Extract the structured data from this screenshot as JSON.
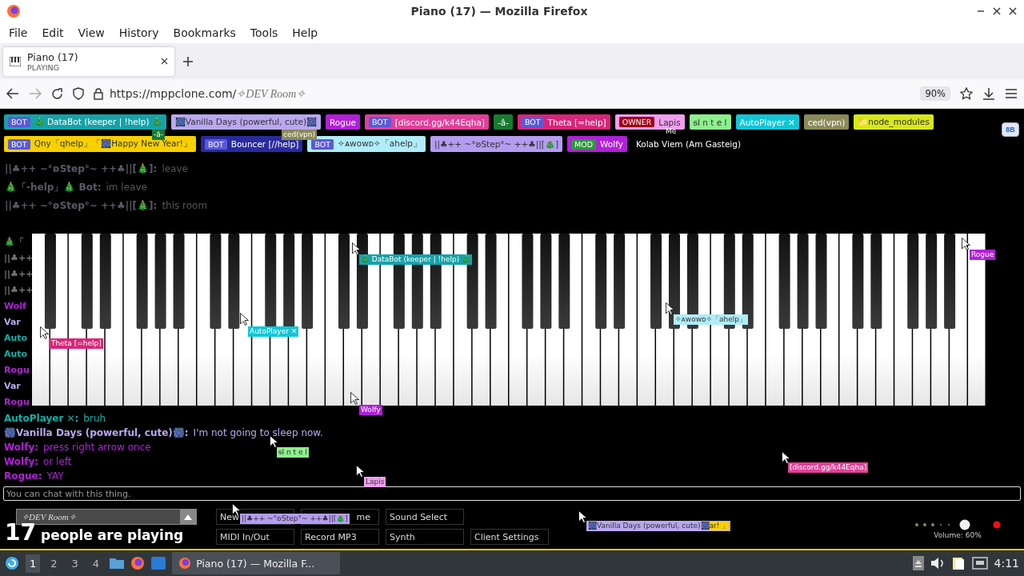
{
  "window": {
    "title": "Piano (17) — Mozilla Firefox"
  },
  "menu": [
    "File",
    "Edit",
    "View",
    "History",
    "Bookmarks",
    "Tools",
    "Help"
  ],
  "tabs": [
    {
      "title": "Piano (17)",
      "subtitle": "PLAYING",
      "selected": true
    }
  ],
  "address": {
    "url": "https://mppclone.com/",
    "room": "✧DEV Room✧",
    "zoom": "90%"
  },
  "users": [
    {
      "name": "🎄 DataBot (keeper | !help) 🎄",
      "color": "#17a2a8",
      "tag": "BOT"
    },
    {
      "name": "🎆Vanilla Days (powerful, cute)🎆",
      "color": "#b9a8f0"
    },
    {
      "name": "Rogue",
      "color": "#b020d8"
    },
    {
      "name": "[discord.gg/k44Eqha]",
      "color": "#e0409a",
      "tag": "BOT"
    },
    {
      "name": "-â-",
      "color": "#1a7a30"
    },
    {
      "name": "Theta [=help]",
      "color": "#d8267a",
      "tag": "BOT"
    },
    {
      "name": "Lapis",
      "color": "#f0a0f0",
      "tag": "OWNER"
    },
    {
      "name": "ᵴI n t e l",
      "color": "#8ef08e"
    },
    {
      "name": "AutoPlayer ✕",
      "color": "#12c6d6"
    },
    {
      "name": "ced(vpn)",
      "color": "#8a8a5a"
    },
    {
      "name": "📁node_modules",
      "color": "#d8e818"
    },
    {
      "name": "Qny「qhelp」「🎆Happy New Year!」",
      "color": "#f8d000",
      "tag": "BOT"
    },
    {
      "name": "Bouncer [//help]",
      "color": "#2a2aa0",
      "tag": "BOT"
    },
    {
      "name": "✧ᴀᴡᴏᴡᴅ✧「ahelp」",
      "color": "#b0ecfa",
      "tag": "BOT"
    },
    {
      "name": "||♣++ ~°ʚStep°~ ++♣||[🎄]",
      "color": "#b49cf0"
    },
    {
      "name": "Wolfy",
      "color": "#b020d8",
      "tag": "MOD"
    },
    {
      "name": "Kolab Viem (Am Gasteig)"
    }
  ],
  "corner_button": "8B",
  "chat": [
    {
      "name": "||♣++ ~°ʚStep°~ ++♣||[🎄]:",
      "text": "leave",
      "faded": true
    },
    {
      "name": "🎄「-help」🎄 Bot:",
      "text": "im leave",
      "faded": true
    },
    {
      "name": "||♣++ ~°ʚStep°~ ++♣||[🎄]:",
      "text": "this room",
      "faded": true
    },
    {
      "name": "AutoPlayer ✕:",
      "text": "bruh",
      "color": "#12b0a8",
      "faded": false
    },
    {
      "name": "🎆Vanilla Days (powerful, cute)🎆:",
      "text": "I'm not going to sleep now.",
      "color": "#b9a8f0",
      "faded": false
    },
    {
      "name": "Wolfy:",
      "text": "press right arrow once",
      "color": "#b020d8",
      "faded": false
    },
    {
      "name": "Wolfy:",
      "text": "or left",
      "color": "#b020d8",
      "faded": false
    },
    {
      "name": "Rogue:",
      "text": "YAY",
      "color": "#b020d8",
      "faded": false
    }
  ],
  "chat_fragments": [
    {
      "text": "🎄「"
    },
    {
      "text": "||♣++"
    },
    {
      "text": "||♣++"
    },
    {
      "text": "||♣++"
    },
    {
      "text": "Wolf",
      "color": "#b020d8"
    },
    {
      "text": "Var",
      "color": "#b9a8f0"
    },
    {
      "text": "Auto",
      "color": "#12b0a8"
    },
    {
      "text": "Auto",
      "color": "#12b0a8"
    },
    {
      "text": "Rogu",
      "color": "#b020d8"
    },
    {
      "text": "Var",
      "color": "#b9a8f0"
    },
    {
      "text": "Rogu",
      "color": "#b020d8"
    }
  ],
  "cursors": [
    {
      "label": "🎄 DataBot (keeper | !help) 🎄",
      "color": "#17a2a8"
    },
    {
      "label": "Rogue",
      "color": "#b020d8"
    },
    {
      "label": "AutoPlayer ✕",
      "color": "#12c6d6"
    },
    {
      "label": "Theta [=help]",
      "color": "#d8267a"
    },
    {
      "label": "✧ᴀᴡᴏᴡᴅ✧「ahelp」",
      "color": "#b0ecfa"
    },
    {
      "label": "Wolfy",
      "color": "#b020d8"
    },
    {
      "label": "ᵴI n t e l",
      "color": "#8ef08e"
    },
    {
      "label": "Lapis",
      "color": "#f0a0f0"
    },
    {
      "label": "[discord.gg/k44Eqha]",
      "color": "#e0409a"
    },
    {
      "label": "||♣++ ~°ʚStep°~ ++♣||[🎄]",
      "color": "#b49cf0"
    },
    {
      "label": "🎆Vanilla Days (powerful, cute)🎆",
      "color": "#b9a8f0",
      "tail": "ar! 」"
    },
    {
      "label": "-â-",
      "color": "#1a7a30"
    },
    {
      "label": "ced(vpn)",
      "color": "#8a8a5a"
    },
    {
      "label": "Me"
    }
  ],
  "chat_input": {
    "placeholder": "You can chat with this thing."
  },
  "room": {
    "name": "✧DEV Room✧",
    "count": "17",
    "caption": "people are playing"
  },
  "buttons": [
    {
      "label": "New"
    },
    {
      "label": "me"
    },
    {
      "label": "Sound Select"
    },
    {
      "label": "MIDI In/Out"
    },
    {
      "label": "Record MP3"
    },
    {
      "label": "Synth"
    },
    {
      "label": "Client Settings"
    }
  ],
  "volume": {
    "label": "Volume: 60%"
  },
  "taskbar": {
    "workspaces": [
      {
        "label": "1",
        "selected": true
      },
      {
        "label": "2",
        "selected": false
      },
      {
        "label": "3",
        "selected": false
      },
      {
        "label": "4",
        "selected": false
      }
    ],
    "task": "Piano (17) — Mozilla F...",
    "clock": "4:11"
  }
}
